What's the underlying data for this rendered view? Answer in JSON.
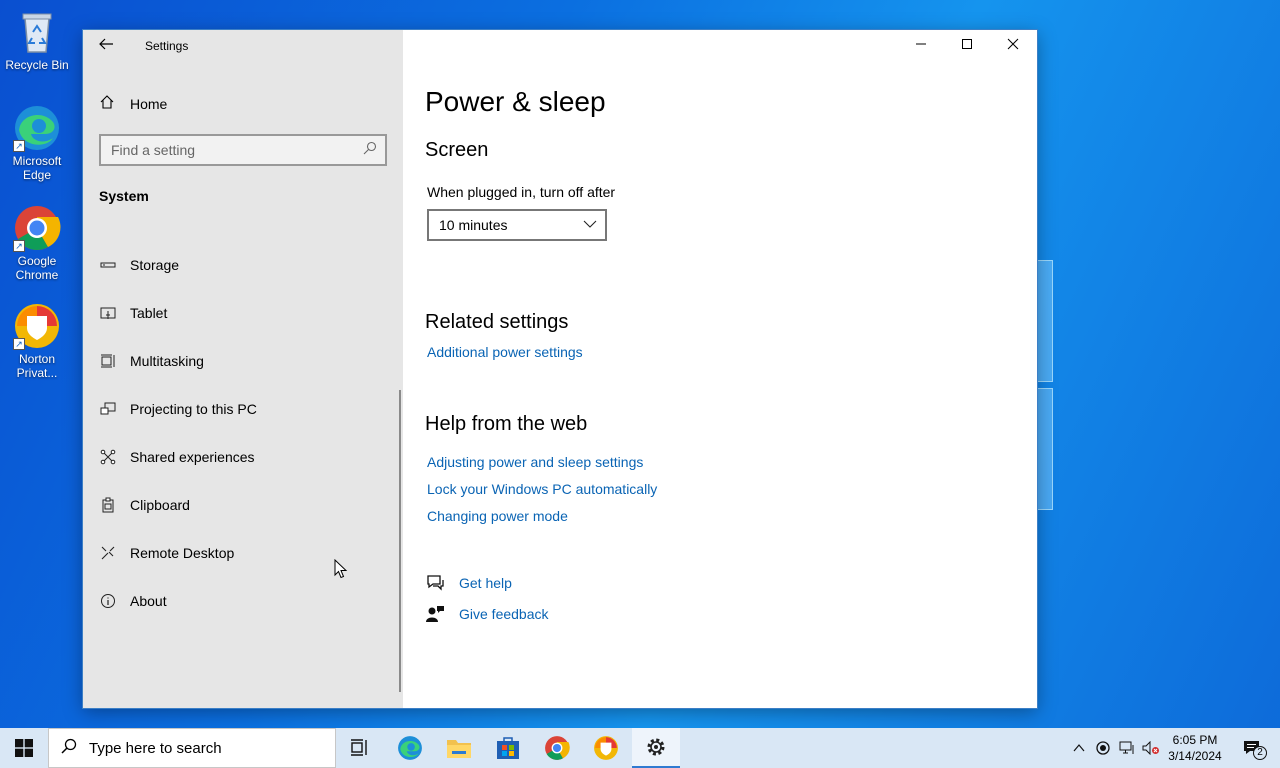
{
  "desktop": {
    "icons": [
      {
        "label": "Recycle Bin"
      },
      {
        "label": "Microsoft Edge"
      },
      {
        "label": "Google Chrome"
      },
      {
        "label": "Norton Privat..."
      }
    ]
  },
  "window": {
    "app_title": "Settings",
    "sidebar": {
      "home_label": "Home",
      "search_placeholder": "Find a setting",
      "section_label": "System",
      "items": [
        {
          "label": "Storage",
          "icon": "storage-icon"
        },
        {
          "label": "Tablet",
          "icon": "tablet-icon"
        },
        {
          "label": "Multitasking",
          "icon": "multitasking-icon"
        },
        {
          "label": "Projecting to this PC",
          "icon": "projecting-icon"
        },
        {
          "label": "Shared experiences",
          "icon": "shared-experiences-icon"
        },
        {
          "label": "Clipboard",
          "icon": "clipboard-icon"
        },
        {
          "label": "Remote Desktop",
          "icon": "remote-desktop-icon"
        },
        {
          "label": "About",
          "icon": "info-icon"
        }
      ]
    },
    "content": {
      "page_title": "Power & sleep",
      "screen_heading": "Screen",
      "plugged_in_label": "When plugged in, turn off after",
      "plugged_in_value": "10 minutes",
      "related_heading": "Related settings",
      "related_link": "Additional power settings",
      "help_heading": "Help from the web",
      "help_links": [
        "Adjusting power and sleep settings",
        "Lock your Windows PC automatically",
        "Changing power mode"
      ],
      "get_help": "Get help",
      "give_feedback": "Give feedback"
    }
  },
  "taskbar": {
    "search_placeholder": "Type here to search",
    "time": "6:05 PM",
    "date": "3/14/2024",
    "notification_count": "2"
  },
  "colors": {
    "link": "#0a64b4",
    "sidebar_bg": "#e6e6e6",
    "taskbar_bg": "#d9e7f5"
  }
}
